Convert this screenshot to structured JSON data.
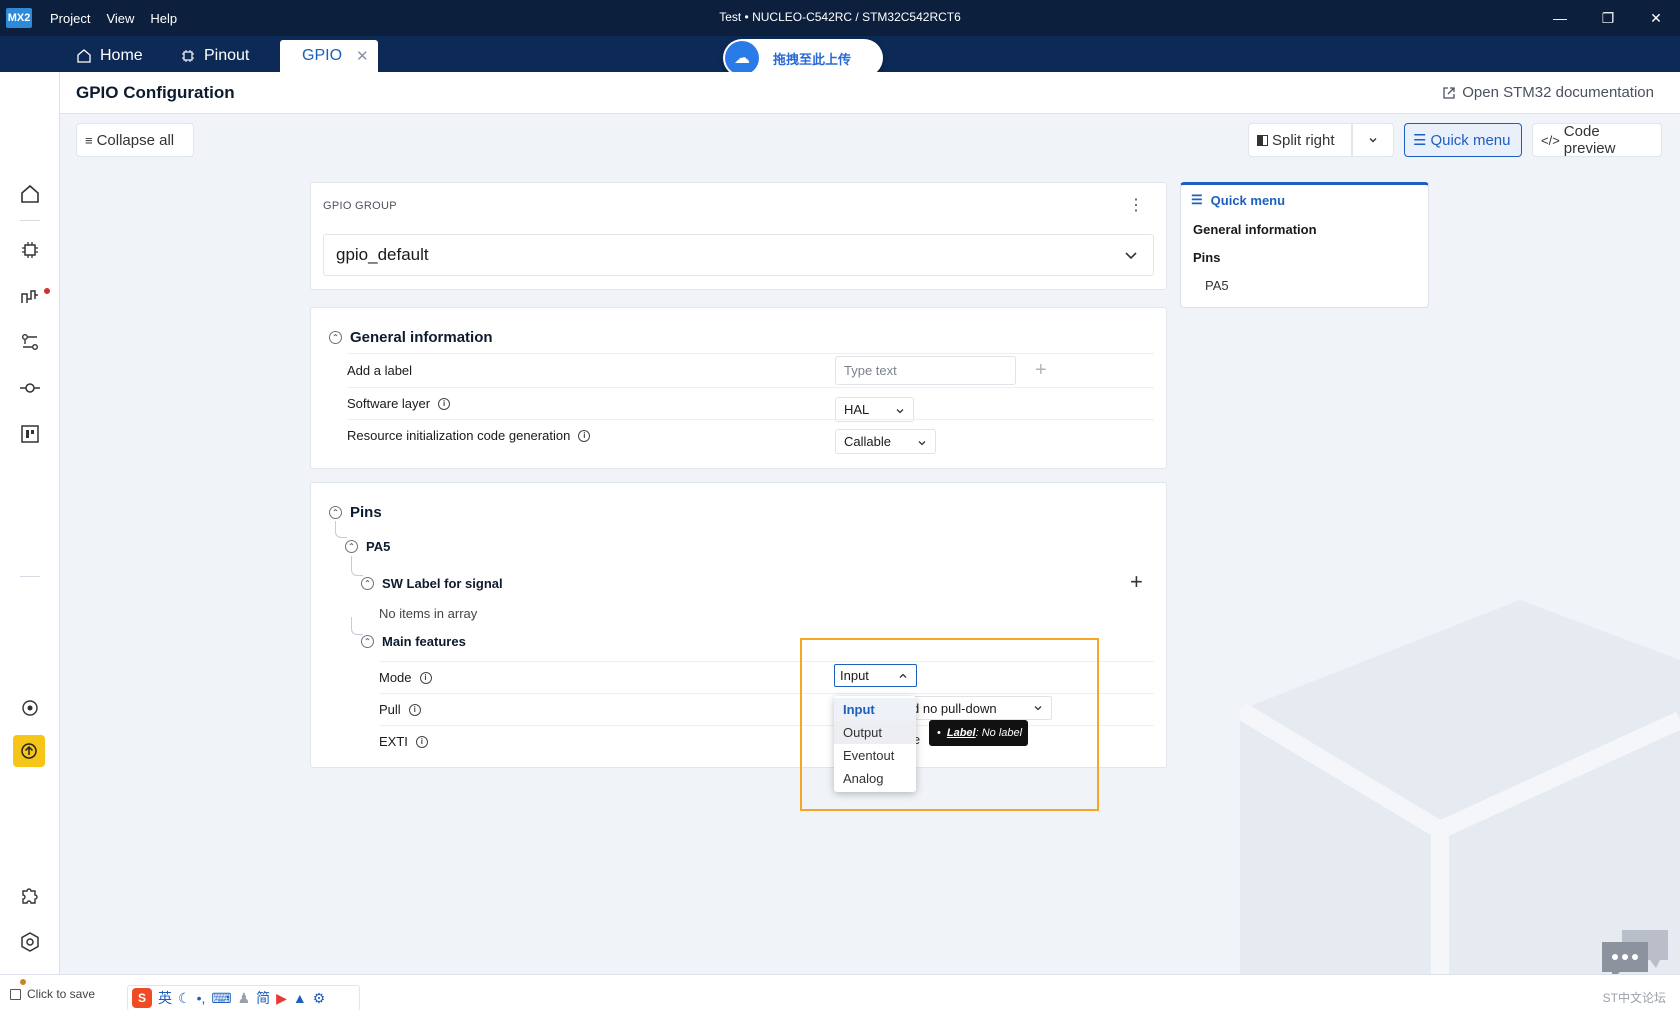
{
  "app": {
    "logo": "MX2",
    "menu": [
      "Project",
      "View",
      "Help"
    ],
    "window_title": "Test  •  NUCLEO-C542RC / STM32C542RCT6",
    "controls": [
      "minimize-icon",
      "restore-icon",
      "close-icon"
    ]
  },
  "tabs": [
    {
      "label": "Home",
      "icon": "home-icon"
    },
    {
      "label": "Pinout",
      "icon": "chip-icon"
    },
    {
      "label": "GPIO",
      "icon": "gpio-icon",
      "active": true
    }
  ],
  "upload_overlay": {
    "label": "拖拽至此上传"
  },
  "header": {
    "title": "GPIO Configuration",
    "doc_link": "Open STM32 documentation"
  },
  "toolbar": {
    "collapse_all": "Collapse all",
    "split_right": "Split right",
    "quick_menu": "Quick menu",
    "code_preview": "Code preview"
  },
  "gpio_group": {
    "label": "GPIO GROUP",
    "value": "gpio_default"
  },
  "general_information": {
    "title": "General information",
    "add_label": {
      "label": "Add a label",
      "placeholder": "Type text"
    },
    "software_layer": {
      "label": "Software layer",
      "value": "HAL"
    },
    "resource_init": {
      "label": "Resource initialization code generation",
      "value": "Callable"
    }
  },
  "pins": {
    "title": "Pins",
    "pin_name": "PA5",
    "sw_label": {
      "title": "SW Label for signal",
      "empty_text": "No items in array"
    },
    "main_features": {
      "title": "Main features",
      "mode": {
        "label": "Mode",
        "value": "Input"
      },
      "pull": {
        "label": "Pull",
        "value_visible": "d no pull-down"
      },
      "exti": {
        "label": "EXTI",
        "value_visible": "le"
      }
    }
  },
  "mode_dropdown": {
    "options": [
      "Input",
      "Output",
      "Eventout",
      "Analog"
    ],
    "selected": "Input",
    "hovered": "Output"
  },
  "tooltip": {
    "key": "Label",
    "value": ": No label"
  },
  "quick_menu_panel": {
    "title": "Quick menu",
    "items": [
      "General information",
      "Pins"
    ],
    "sub_items": [
      "PA5"
    ]
  },
  "status_bar": {
    "save_text": "Click to save",
    "ime_labels": [
      "英",
      "简"
    ],
    "right_text": "ST中文论坛"
  },
  "colors": {
    "titlebar": "#0c1f3d",
    "tabbar": "#0c2a55",
    "accent": "#1d5fbf",
    "highlight": "#f5a623",
    "warning_button": "#f5c518"
  }
}
